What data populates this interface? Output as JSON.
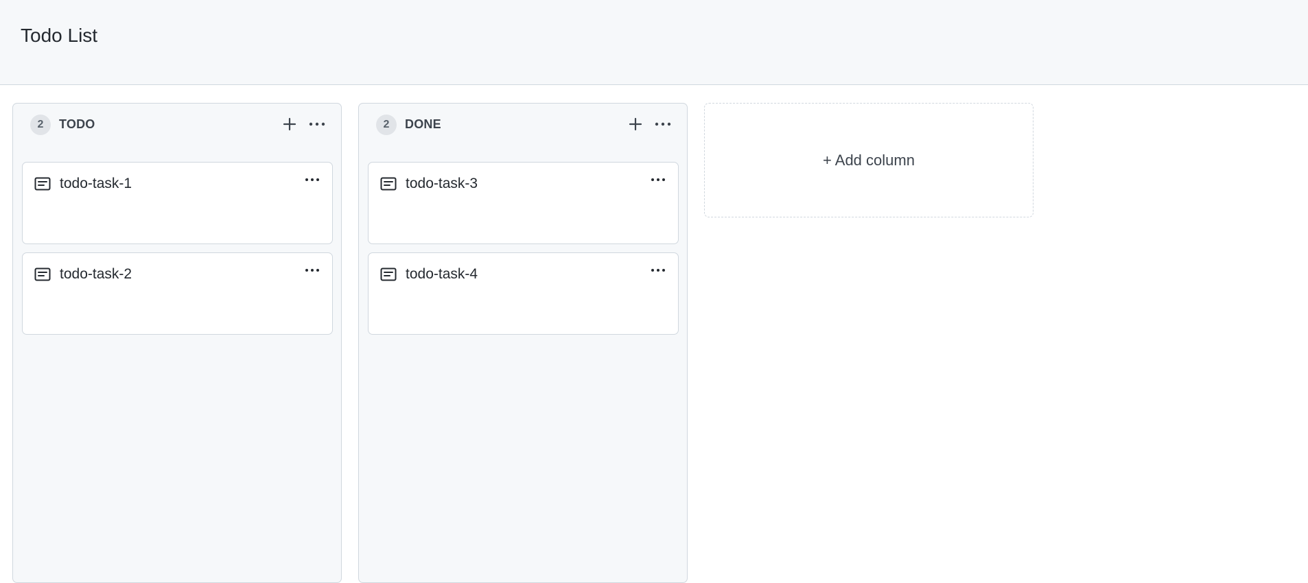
{
  "header": {
    "title": "Todo List"
  },
  "columns": [
    {
      "count": "2",
      "title": "TODO",
      "cards": [
        {
          "title": "todo-task-1",
          "icon": "note-icon"
        },
        {
          "title": "todo-task-2",
          "icon": "note-icon"
        }
      ]
    },
    {
      "count": "2",
      "title": "DONE",
      "cards": [
        {
          "title": "todo-task-3",
          "icon": "note-icon"
        },
        {
          "title": "todo-task-4",
          "icon": "note-icon"
        }
      ]
    }
  ],
  "add_column": {
    "label": "+ Add column"
  },
  "colors": {
    "header_bg": "#f6f8fa",
    "column_bg": "#f6f8fa",
    "border": "#d0d7de",
    "text": "#24292f"
  }
}
